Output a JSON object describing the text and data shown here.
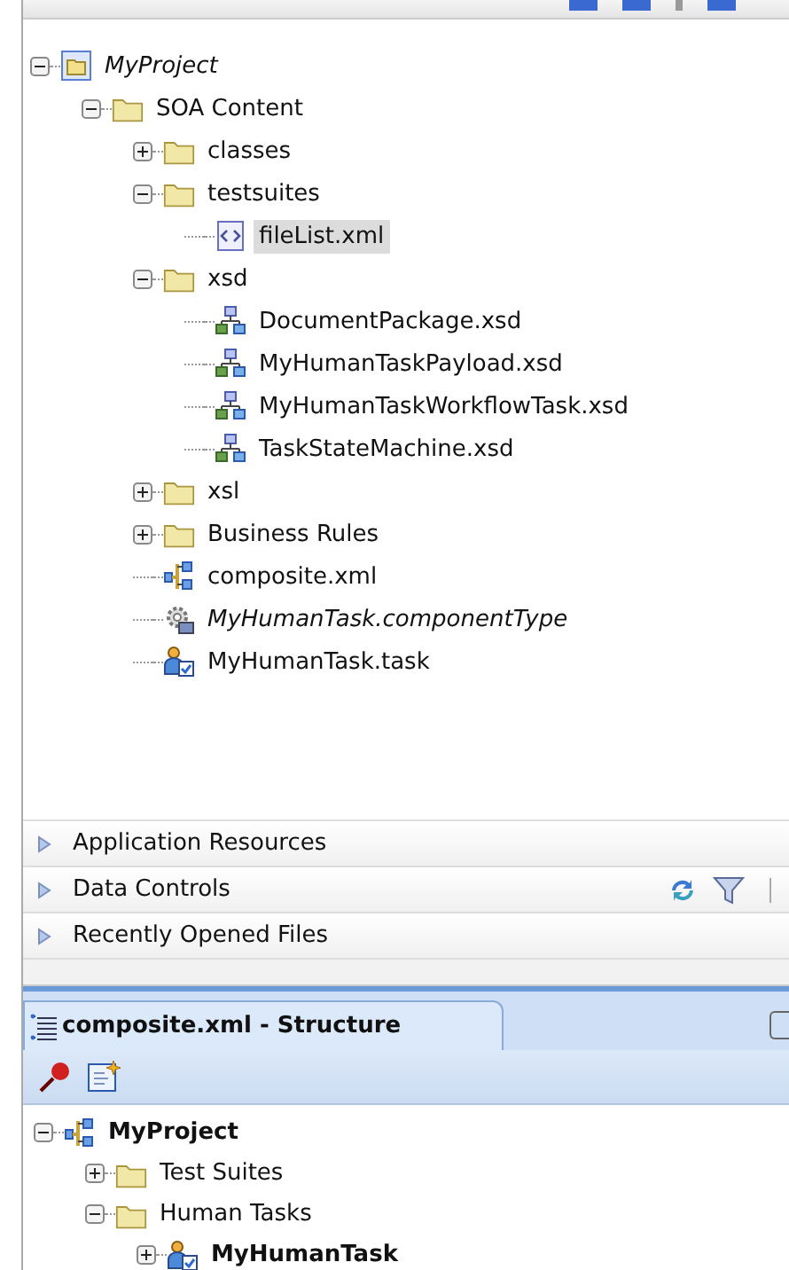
{
  "project_tree": {
    "items": [
      {
        "label": "MyProject",
        "kind": "project",
        "italic": true,
        "expanded": true,
        "selected": false,
        "children": [
          {
            "label": "SOA Content",
            "kind": "folder",
            "expanded": true,
            "selected": false,
            "children": [
              {
                "label": "classes",
                "kind": "folder",
                "expanded": false,
                "selected": false
              },
              {
                "label": "testsuites",
                "kind": "folder",
                "expanded": true,
                "selected": false,
                "children": [
                  {
                    "label": "fileList.xml",
                    "kind": "xml",
                    "selected": true
                  }
                ]
              },
              {
                "label": "xsd",
                "kind": "folder",
                "expanded": true,
                "selected": false,
                "children": [
                  {
                    "label": "DocumentPackage.xsd",
                    "kind": "schema",
                    "selected": false
                  },
                  {
                    "label": "MyHumanTaskPayload.xsd",
                    "kind": "schema",
                    "selected": false
                  },
                  {
                    "label": "MyHumanTaskWorkflowTask.xsd",
                    "kind": "schema",
                    "selected": false
                  },
                  {
                    "label": "TaskStateMachine.xsd",
                    "kind": "schema",
                    "selected": false
                  }
                ]
              },
              {
                "label": "xsl",
                "kind": "folder",
                "expanded": false,
                "selected": false
              },
              {
                "label": "Business Rules",
                "kind": "folder",
                "expanded": false,
                "selected": false
              },
              {
                "label": "composite.xml",
                "kind": "composite",
                "selected": false
              },
              {
                "label": "MyHumanTask.componentType",
                "kind": "gear",
                "italic": true,
                "selected": false
              },
              {
                "label": "MyHumanTask.task",
                "kind": "task",
                "selected": false
              }
            ]
          }
        ]
      }
    ]
  },
  "accordion": [
    {
      "label": "Application Resources",
      "expanded": false,
      "tools": false
    },
    {
      "label": "Data Controls",
      "expanded": false,
      "tools": true
    },
    {
      "label": "Recently Opened Files",
      "expanded": false,
      "tools": false
    }
  ],
  "structure": {
    "tab": "composite.xml - Structure",
    "items": [
      {
        "label": "MyProject",
        "kind": "composite",
        "bold": true,
        "expanded": true,
        "selected": false,
        "children": [
          {
            "label": "Test Suites",
            "kind": "folder",
            "expanded": false,
            "selected": false
          },
          {
            "label": "Human Tasks",
            "kind": "folder",
            "expanded": true,
            "selected": false,
            "children": [
              {
                "label": "MyHumanTask",
                "kind": "task",
                "bold": true,
                "expanded": false,
                "selected": false
              }
            ]
          }
        ]
      }
    ]
  }
}
